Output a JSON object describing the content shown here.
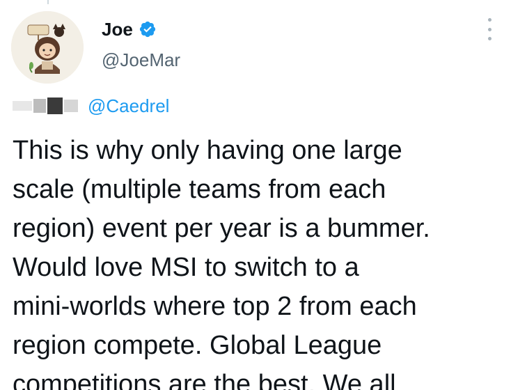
{
  "author": {
    "display_name": "Joe",
    "handle": "@JoeMar",
    "verified": true,
    "avatar_icon": "cartoon-character-avatar"
  },
  "reply": {
    "mention": "@Caedrel"
  },
  "tweet": {
    "lines": [
      "This is why only having one large",
      "scale (multiple teams from each",
      "region) event per year is a bummer.",
      "Would love MSI to switch to a",
      "mini-worlds where top 2 from each",
      "region compete.  Global League",
      "competitions are the best. We all"
    ]
  },
  "colors": {
    "accent": "#1d9bf0",
    "text_primary": "#0f1419",
    "text_secondary": "#536471"
  },
  "icons": {
    "verified": "verified-badge-icon",
    "more": "more-options-icon"
  }
}
